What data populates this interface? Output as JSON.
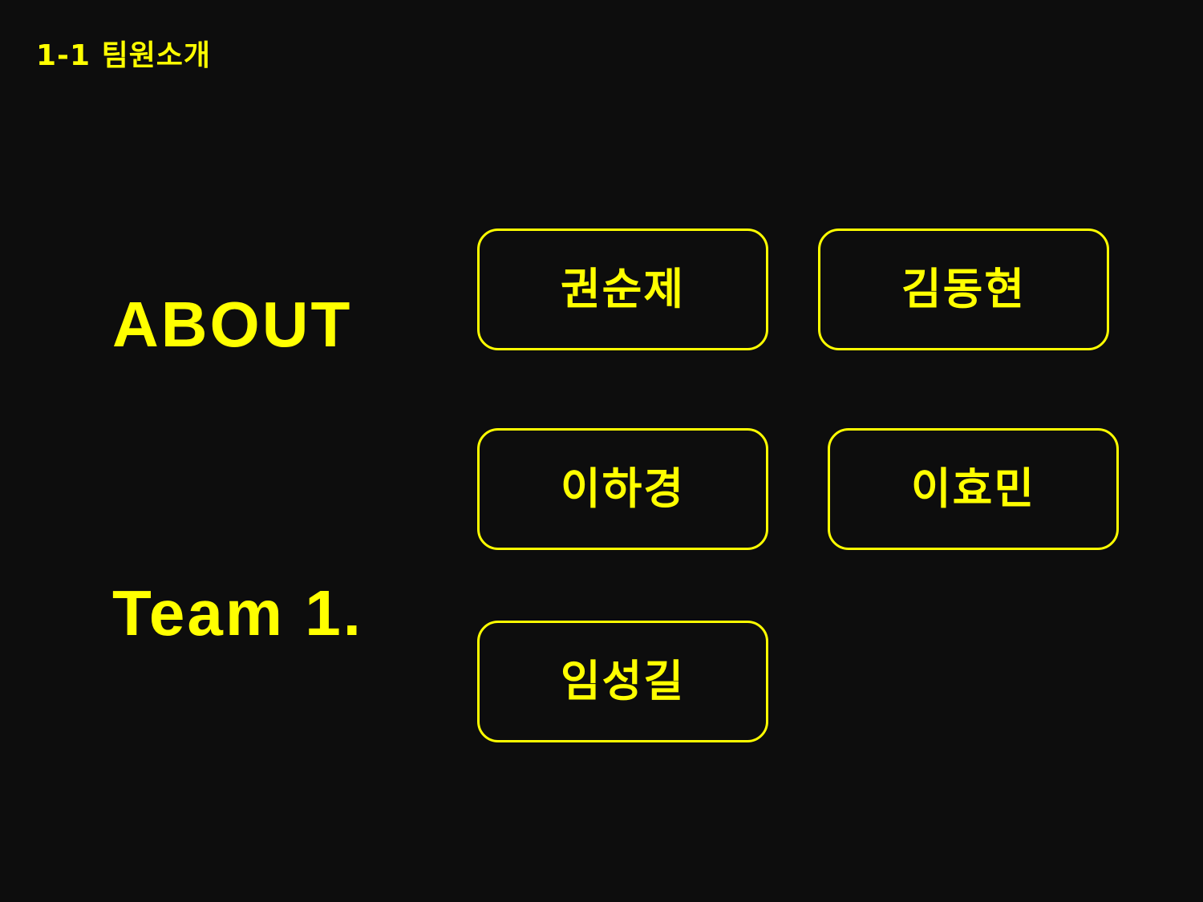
{
  "section_title": "1-1 팀원소개",
  "headings": {
    "about": "ABOUT",
    "team": "Team 1."
  },
  "members": [
    {
      "name": "권순제"
    },
    {
      "name": "김동현"
    },
    {
      "name": "이하경"
    },
    {
      "name": "이효민"
    },
    {
      "name": "임성길"
    }
  ],
  "colors": {
    "background": "#0d0d0d",
    "accent": "#ffff00"
  }
}
